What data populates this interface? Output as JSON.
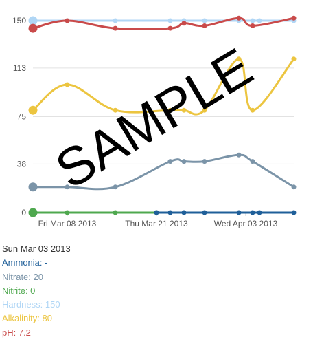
{
  "chart_data": {
    "type": "line",
    "yticks": [
      0,
      38,
      75,
      113,
      150
    ],
    "ylim": [
      0,
      150
    ],
    "xticks": [
      {
        "date": "2013-03-08",
        "label": "Fri Mar 08 2013"
      },
      {
        "date": "2013-03-21",
        "label": "Thu Mar 21 2013"
      },
      {
        "date": "2013-04-03",
        "label": "Wed Apr 03 2013"
      }
    ],
    "xlim": [
      "2013-03-03",
      "2013-04-10"
    ],
    "grid": true,
    "watermark": "SAMPLE",
    "series": [
      {
        "name": "Hardness",
        "color": "#b0d6f5",
        "points": [
          [
            "2013-03-03",
            150
          ],
          [
            "2013-03-08",
            150
          ],
          [
            "2013-03-15",
            150
          ],
          [
            "2013-03-23",
            150
          ],
          [
            "2013-03-25",
            150
          ],
          [
            "2013-03-28",
            150
          ],
          [
            "2013-04-02",
            150
          ],
          [
            "2013-04-04",
            150
          ],
          [
            "2013-04-05",
            150
          ],
          [
            "2013-04-10",
            150
          ]
        ]
      },
      {
        "name": "Alkalinity",
        "color": "#ecc540",
        "points": [
          [
            "2013-03-03",
            80
          ],
          [
            "2013-03-08",
            100
          ],
          [
            "2013-03-15",
            80
          ],
          [
            "2013-03-23",
            80
          ],
          [
            "2013-03-25",
            80
          ],
          [
            "2013-03-28",
            80
          ],
          [
            "2013-04-02",
            120
          ],
          [
            "2013-04-04",
            80
          ],
          [
            "2013-04-10",
            120
          ]
        ]
      },
      {
        "name": "Nitrate",
        "color": "#7b94a8",
        "points": [
          [
            "2013-03-03",
            20
          ],
          [
            "2013-03-08",
            20
          ],
          [
            "2013-03-15",
            20
          ],
          [
            "2013-03-23",
            40
          ],
          [
            "2013-03-25",
            40
          ],
          [
            "2013-03-28",
            40
          ],
          [
            "2013-04-02",
            45
          ],
          [
            "2013-04-04",
            40
          ],
          [
            "2013-04-10",
            20
          ]
        ]
      },
      {
        "name": "pH",
        "color": "#c94a4a",
        "scale": 20,
        "points": [
          [
            "2013-03-03",
            7.2
          ],
          [
            "2013-03-08",
            7.5
          ],
          [
            "2013-03-15",
            7.2
          ],
          [
            "2013-03-23",
            7.2
          ],
          [
            "2013-03-25",
            7.4
          ],
          [
            "2013-03-28",
            7.3
          ],
          [
            "2013-04-02",
            7.6
          ],
          [
            "2013-04-04",
            7.3
          ],
          [
            "2013-04-10",
            7.6
          ]
        ]
      },
      {
        "name": "Nitrite",
        "color": "#4fa84f",
        "points": [
          [
            "2013-03-03",
            0
          ],
          [
            "2013-03-08",
            0
          ],
          [
            "2013-03-15",
            0
          ],
          [
            "2013-03-21",
            0
          ]
        ]
      },
      {
        "name": "Ammonia",
        "color": "#1f5f99",
        "points": [
          [
            "2013-03-21",
            0
          ],
          [
            "2013-03-23",
            0
          ],
          [
            "2013-03-25",
            0
          ],
          [
            "2013-03-28",
            0
          ],
          [
            "2013-04-02",
            0
          ],
          [
            "2013-04-04",
            0
          ],
          [
            "2013-04-05",
            0
          ],
          [
            "2013-04-10",
            0
          ]
        ]
      }
    ]
  },
  "tooltip": {
    "date": "Sun Mar 03 2013",
    "rows": [
      {
        "text": "Ammonia: -",
        "color": "#1f5f99"
      },
      {
        "text": "Nitrate: 20",
        "color": "#7b94a8"
      },
      {
        "text": "Nitrite: 0",
        "color": "#4fa84f"
      },
      {
        "text": "Hardness: 150",
        "color": "#b0d6f5"
      },
      {
        "text": "Alkalinity: 80",
        "color": "#ecc540"
      },
      {
        "text": "pH: 7.2",
        "color": "#c94a4a"
      }
    ]
  }
}
